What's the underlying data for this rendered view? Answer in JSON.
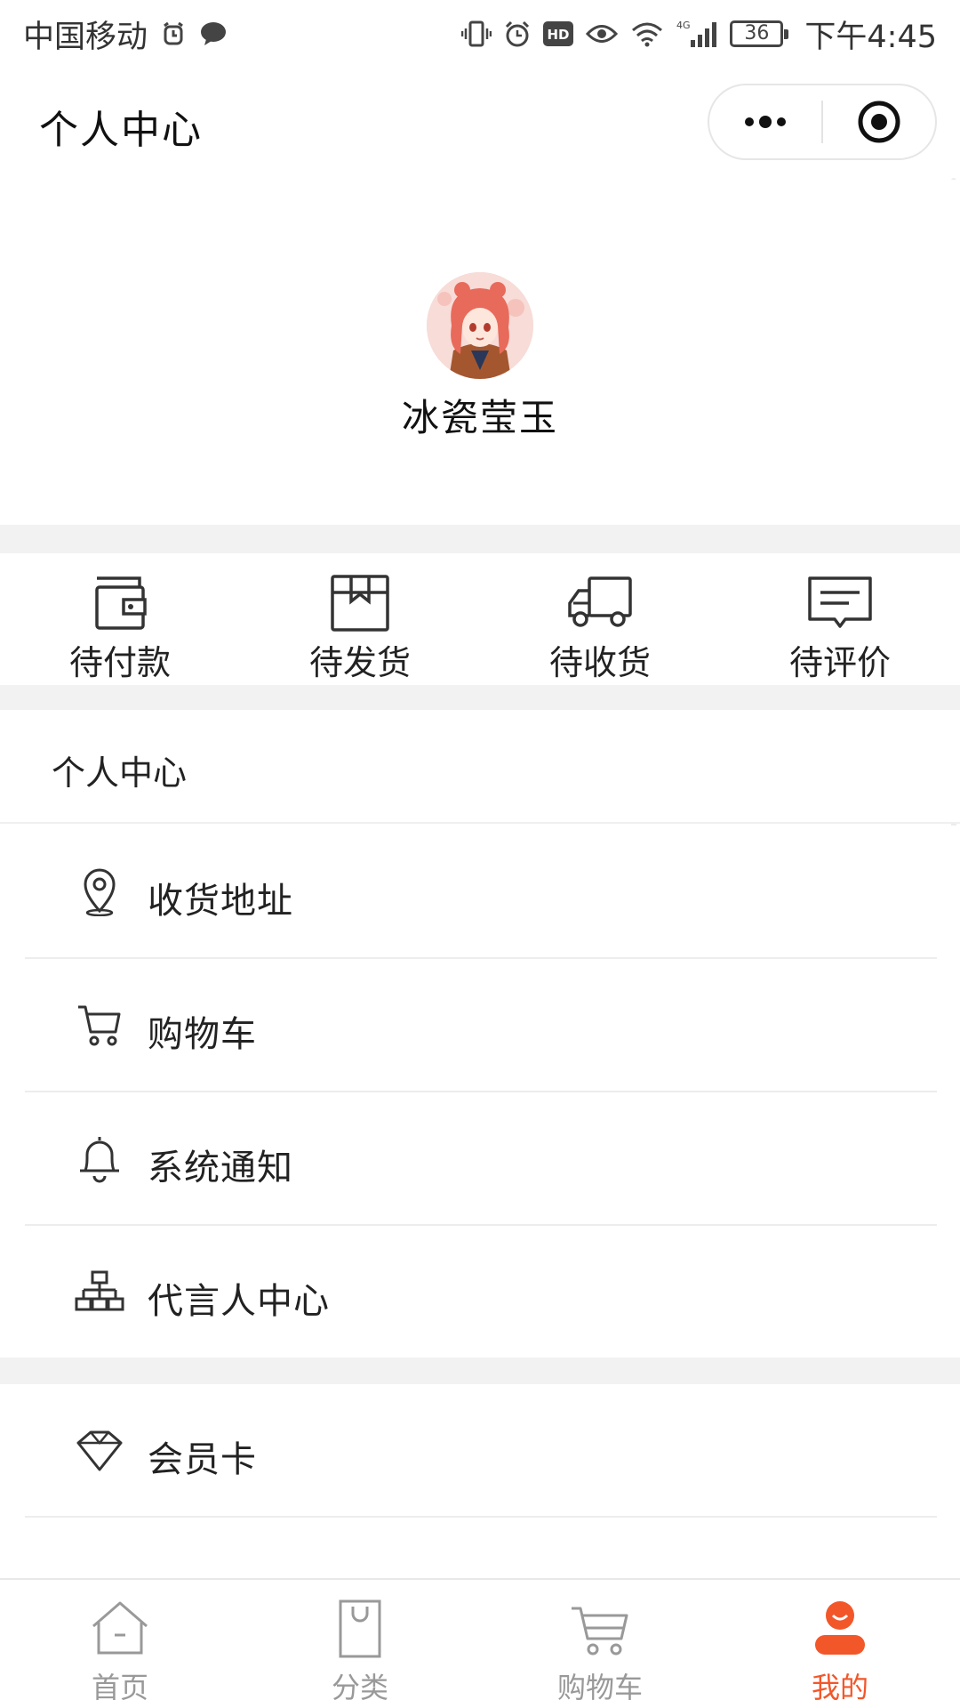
{
  "status_bar": {
    "carrier": "中国移动",
    "battery": "36",
    "time": "下午4:45"
  },
  "header": {
    "title": "个人中心"
  },
  "profile": {
    "username": "冰瓷莹玉"
  },
  "orders": [
    {
      "label": "待付款",
      "icon": "wallet-icon"
    },
    {
      "label": "待发货",
      "icon": "package-icon"
    },
    {
      "label": "待收货",
      "icon": "truck-icon"
    },
    {
      "label": "待评价",
      "icon": "comment-icon"
    }
  ],
  "menu": {
    "section_title": "个人中心",
    "items": [
      {
        "label": "收货地址",
        "icon": "location-pin-icon"
      },
      {
        "label": "购物车",
        "icon": "cart-icon"
      },
      {
        "label": "系统通知",
        "icon": "bell-icon"
      },
      {
        "label": "代言人中心",
        "icon": "org-chart-icon"
      },
      {
        "label": "会员卡",
        "icon": "diamond-icon"
      }
    ]
  },
  "tabbar": {
    "items": [
      {
        "label": "首页",
        "icon": "home-icon",
        "active": false
      },
      {
        "label": "分类",
        "icon": "bag-icon",
        "active": false
      },
      {
        "label": "购物车",
        "icon": "cart-icon",
        "active": false
      },
      {
        "label": "我的",
        "icon": "user-icon",
        "active": true
      }
    ],
    "active_color": "#f2572a",
    "inactive_color": "#999999"
  }
}
